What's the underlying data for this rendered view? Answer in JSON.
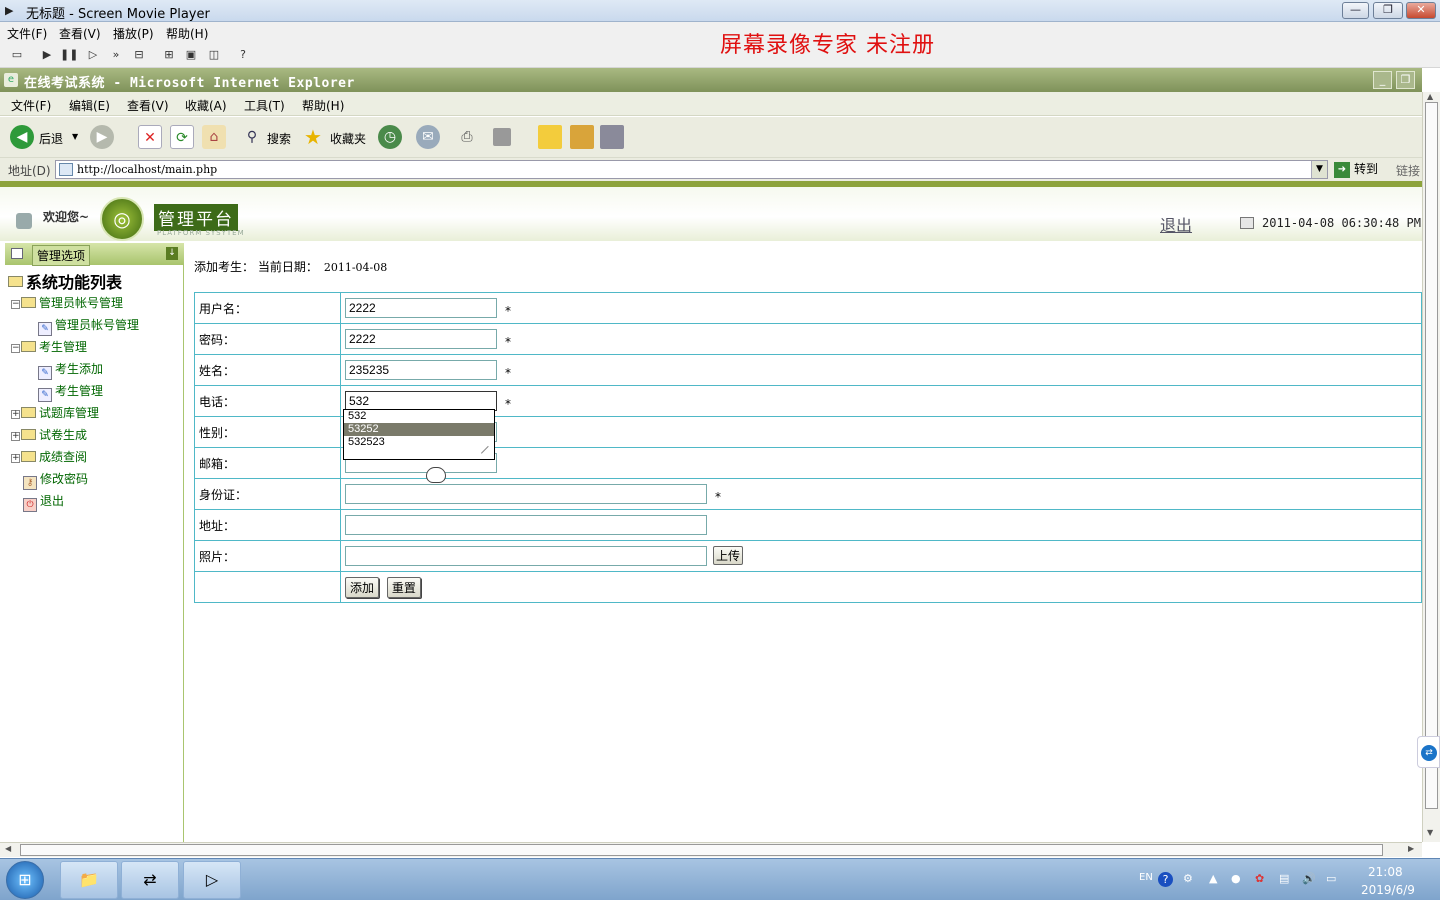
{
  "player": {
    "title": "无标题 - Screen Movie Player",
    "menu": [
      "文件(F)",
      "查看(V)",
      "播放(P)",
      "帮助(H)"
    ],
    "watermark": "屏幕录像专家  未注册",
    "toolbar_icons": [
      "open-icon",
      "play-icon",
      "pause-icon",
      "step-icon",
      "fast-forward-icon",
      "record-icon",
      "fit-icon",
      "fullscreen-icon",
      "window-icon",
      "help-icon"
    ]
  },
  "ie": {
    "title": "在线考试系统 - Microsoft Internet Explorer",
    "menu": [
      "文件(F)",
      "编辑(E)",
      "查看(V)",
      "收藏(A)",
      "工具(T)",
      "帮助(H)"
    ],
    "toolbar": {
      "back": "后退",
      "search": "搜索",
      "favorites": "收藏夹"
    },
    "address_label": "地址(D)",
    "url": "http://localhost/main.php",
    "go": "转到",
    "links": "链接"
  },
  "banner": {
    "welcome": "欢迎您~",
    "logo_title": "管理平台",
    "logo_sub": "PLATFORM SYSYTEM",
    "logout": "退出",
    "datetime": "2011-04-08 06:30:48 PM"
  },
  "sidebar": {
    "header": "管理选项",
    "tree_title": "系统功能列表",
    "items": [
      {
        "label": "管理员帐号管理",
        "type": "folder"
      },
      {
        "label": "管理员帐号管理",
        "type": "doc"
      },
      {
        "label": "考生管理",
        "type": "folder"
      },
      {
        "label": "考生添加",
        "type": "doc"
      },
      {
        "label": "考生管理",
        "type": "doc"
      },
      {
        "label": "试题库管理",
        "type": "folder"
      },
      {
        "label": "试卷生成",
        "type": "folder"
      },
      {
        "label": "成绩查阅",
        "type": "folder"
      },
      {
        "label": "修改密码",
        "type": "item"
      },
      {
        "label": "退出",
        "type": "item"
      }
    ]
  },
  "form": {
    "breadcrumb": "添加考生： 当前日期：",
    "date": "2011-04-08",
    "fields": {
      "username": {
        "label": "用户名：",
        "value": "2222"
      },
      "password": {
        "label": "密码：",
        "value": "2222"
      },
      "name": {
        "label": "姓名：",
        "value": "235235"
      },
      "phone": {
        "label": "电话：",
        "value": "532"
      },
      "gender": {
        "label": "性别：",
        "value": ""
      },
      "email": {
        "label": "邮箱：",
        "value": ""
      },
      "idcard": {
        "label": "身份证：",
        "value": ""
      },
      "address": {
        "label": "地址：",
        "value": ""
      },
      "photo": {
        "label": "照片：",
        "value": ""
      }
    },
    "required_mark": "*",
    "upload": "上传",
    "submit": "添加",
    "reset": "重置",
    "autocomplete": [
      "532",
      "53252",
      "532523"
    ],
    "autocomplete_selected": 1
  },
  "taskbar": {
    "tray_lang": "EN",
    "time": "21:08",
    "date": "2019/6/9"
  }
}
